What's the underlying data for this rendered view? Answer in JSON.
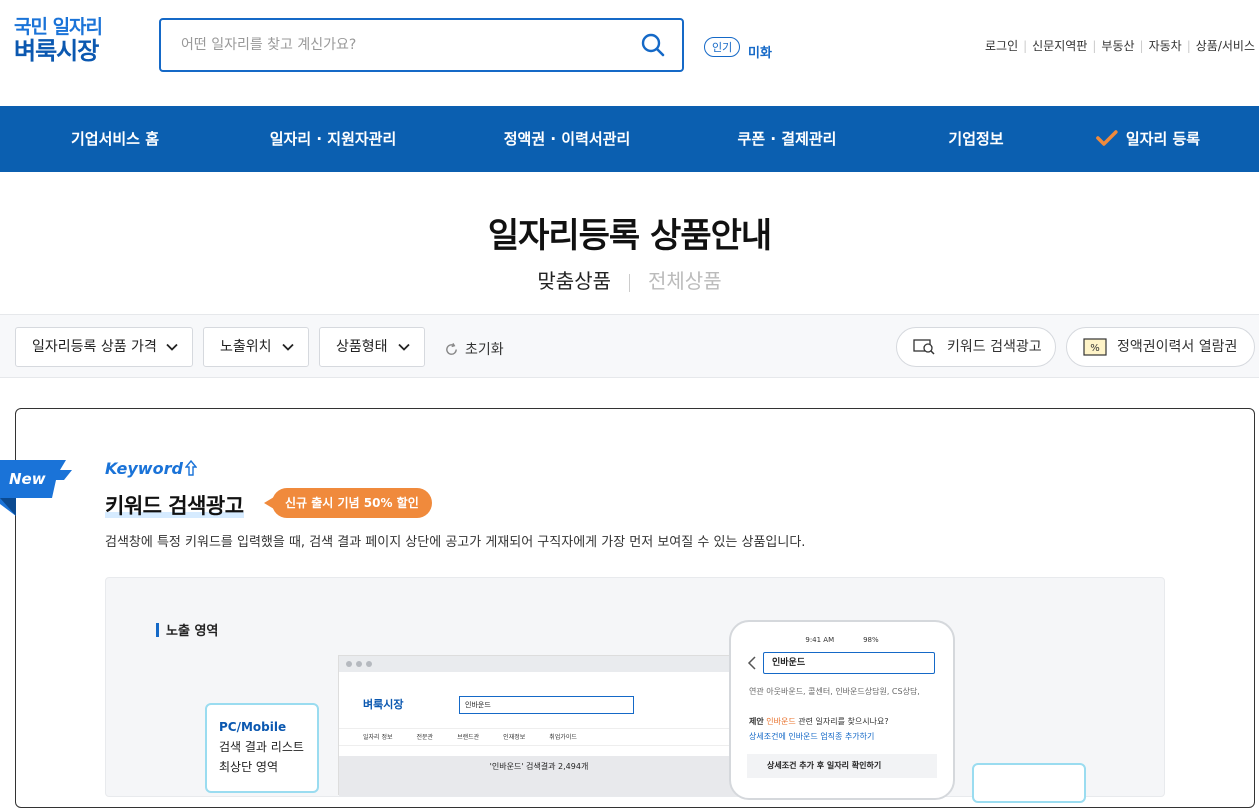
{
  "header": {
    "logo_line1": "국민 일자리",
    "logo_line2": "벼룩시장",
    "search_placeholder": "어떤 일자리를 찾고 계신가요?",
    "popular_badge": "인기",
    "popular_keyword": "미화",
    "top_links": [
      "로그인",
      "신문지역판",
      "부동산",
      "자동차",
      "상품/서비스"
    ]
  },
  "main_nav": [
    "기업서비스 홈",
    "일자리 · 지원자관리",
    "정액권 · 이력서관리",
    "쿠폰 · 결제관리",
    "기업정보",
    "일자리 등록"
  ],
  "page": {
    "title": "일자리등록 상품안내",
    "tab_active": "맞춤상품",
    "tab_inactive": "전체상품"
  },
  "filters": {
    "dropdowns": [
      "일자리등록 상품 가격",
      "노출위치",
      "상품형태"
    ],
    "reset": "초기화",
    "pills": [
      "키워드 검색광고",
      "정액권이력서 열람권"
    ]
  },
  "product": {
    "new_flag": "New",
    "eyebrow": "Keyword",
    "title": "키워드 검색광고",
    "promo": "신규 출시 기념 50% 할인",
    "description": "검색창에 특정 키워드를 입력했을 때, 검색 결과 페이지 상단에 공고가 게재되어 구직자에게 가장 먼저 보여질 수 있는 상품입니다.",
    "exposure_title": "노출 영역",
    "pc_box": [
      "PC/Mobile",
      "검색 결과 리스트",
      "최상단 영역"
    ]
  },
  "mock_browser": {
    "logo": "벼룩시장",
    "search_value": "인바운드",
    "nav": [
      "일자리 정보",
      "전문관",
      "브랜드관",
      "인재정보",
      "취업가이드"
    ],
    "result": "'인바운드' 검색결과 2,494개"
  },
  "mock_phone": {
    "status": "9:41 AM",
    "battery": "98%",
    "search_value": "인바운드",
    "related": "연관  아웃바운드, 콜센터, 인바운드상담원, CS상담,",
    "suggest_prefix": "제안",
    "suggest_kw": "인바운드",
    "suggest_rest": "관련 일자리를 찾으시나요?",
    "suggest_link": "상세조건에 인바운드 업직종 추가하기",
    "condition": "상세조건 추가 후 일자리 확인하기"
  },
  "colors": {
    "brand_blue": "#0b5fb0",
    "accent_blue": "#1569c7",
    "promo_orange": "#f08a3c"
  }
}
